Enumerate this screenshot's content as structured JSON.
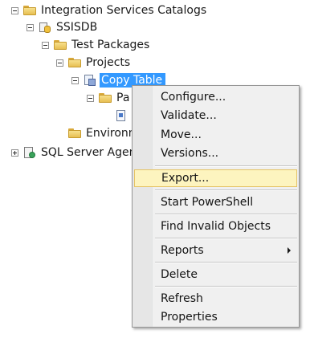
{
  "tree": {
    "root_label": "Integration Services Catalogs",
    "ssisdb_label": "SSISDB",
    "folder_label": "Test Packages",
    "projects_label": "Projects",
    "project_label": "Copy Table",
    "packages_label": "Pa",
    "environments_label": "Environn",
    "agent_label": "SQL Server Agent"
  },
  "context_menu": {
    "configure": "Configure...",
    "validate": "Validate...",
    "move": "Move...",
    "versions": "Versions...",
    "export": "Export...",
    "start_powershell": "Start PowerShell",
    "find_invalid_objects": "Find Invalid Objects",
    "reports": "Reports",
    "delete": "Delete",
    "refresh": "Refresh",
    "properties": "Properties",
    "highlighted_item": "Export...",
    "highlight_color": "#fdf4bf"
  },
  "colors": {
    "selection": "#3399ff"
  },
  "icons": [
    "expand-collapse-icon",
    "folder-icon",
    "database-icon",
    "project-icon",
    "package-icon",
    "sql-agent-icon",
    "submenu-arrow-icon"
  ]
}
